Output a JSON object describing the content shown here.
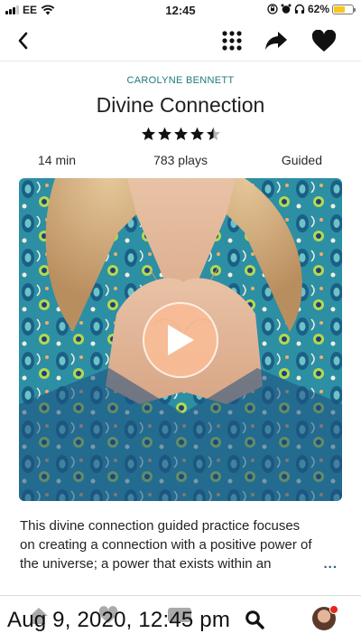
{
  "status_bar": {
    "carrier": "EE",
    "time": "12:45",
    "battery_percent": "62%",
    "battery_level": 0.62,
    "battery_color": "#f7c720",
    "icons": [
      "signal-icon",
      "wifi-icon",
      "screen-lock-icon",
      "alarm-icon",
      "headphones-icon",
      "battery-icon"
    ]
  },
  "nav": {
    "icons": [
      "back-chevron-icon",
      "grid-dots-icon",
      "share-arrow-icon",
      "heart-icon"
    ]
  },
  "meditation": {
    "author": "CAROLYNE BENNETT",
    "title": "Divine Connection",
    "rating": 4.5,
    "rating_max": 5,
    "duration": "14 min",
    "plays": "783 plays",
    "type": "Guided",
    "description": "This divine connection guided practice focuses on creating a connection with a positive power of the universe; a power that exists within an",
    "more_label": "..."
  },
  "colors": {
    "accent_teal": "#1f7a78",
    "more_link": "#1f5f86",
    "play_button": "#f8bc96"
  },
  "tab_bar": {
    "icons": [
      "home-icon",
      "heart-icon",
      "timer-badge-icon",
      "search-icon",
      "profile-avatar"
    ],
    "has_notification": true
  },
  "overlay": {
    "timestamp": "Aug 9, 2020, 12:45 pm"
  }
}
